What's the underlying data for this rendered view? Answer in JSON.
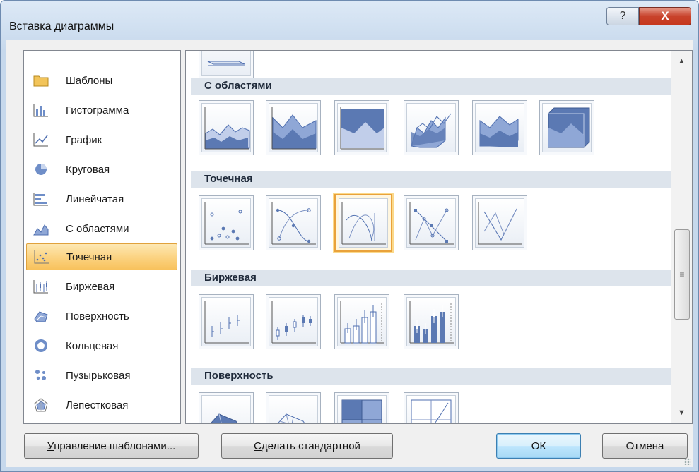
{
  "window": {
    "title": "Вставка диаграммы",
    "help_glyph": "?",
    "close_glyph": "X"
  },
  "categories": [
    {
      "label": "Шаблоны",
      "icon": "folder-icon",
      "selected": false
    },
    {
      "label": "Гистограмма",
      "icon": "column-chart-icon",
      "selected": false
    },
    {
      "label": "График",
      "icon": "line-chart-icon",
      "selected": false
    },
    {
      "label": "Круговая",
      "icon": "pie-chart-icon",
      "selected": false
    },
    {
      "label": "Линейчатая",
      "icon": "bar-chart-icon",
      "selected": false
    },
    {
      "label": "С областями",
      "icon": "area-chart-icon",
      "selected": false
    },
    {
      "label": "Точечная",
      "icon": "scatter-chart-icon",
      "selected": true
    },
    {
      "label": "Биржевая",
      "icon": "stock-chart-icon",
      "selected": false
    },
    {
      "label": "Поверхность",
      "icon": "surface-chart-icon",
      "selected": false
    },
    {
      "label": "Кольцевая",
      "icon": "doughnut-chart-icon",
      "selected": false
    },
    {
      "label": "Пузырьковая",
      "icon": "bubble-chart-icon",
      "selected": false
    },
    {
      "label": "Лепестковая",
      "icon": "radar-chart-icon",
      "selected": false
    }
  ],
  "gallery": {
    "sections": [
      {
        "title": "С областями",
        "count": 6
      },
      {
        "title": "Точечная",
        "count": 5,
        "selected_index": 2
      },
      {
        "title": "Биржевая",
        "count": 4
      },
      {
        "title": "Поверхность",
        "count": 4
      }
    ]
  },
  "scrollbar": {
    "up_glyph": "▲",
    "down_glyph": "▼",
    "thumb_grip": "≡"
  },
  "buttons": {
    "manage_templates": {
      "accel": "У",
      "rest": "правление шаблонами..."
    },
    "set_default": {
      "accel": "С",
      "rest": "делать стандартной"
    },
    "ok": "ОК",
    "cancel": "Отмена"
  },
  "colors": {
    "selection_fill": "#fbd27f",
    "selection_border": "#e0a23c",
    "section_header": "#dde4ec",
    "chart_blue": "#5b79b3"
  }
}
